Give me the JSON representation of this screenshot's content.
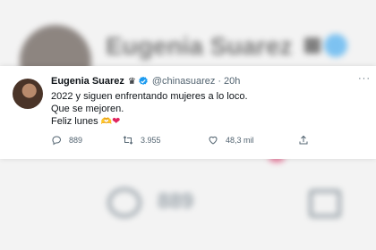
{
  "background": {
    "name": "Eugenia Suarez",
    "reply_count": "889"
  },
  "tweet": {
    "display_name": "Eugenia Suarez",
    "crown_emoji": "♛",
    "handle": "@chinasuarez",
    "separator": "·",
    "time": "20h",
    "more": "···",
    "lines": [
      "2022 y siguen enfrentando mujeres a lo loco.",
      "Que se mejoren.",
      "Feliz lunes"
    ],
    "emoji_1": "🫶",
    "emoji_2": "❤"
  },
  "actions": {
    "replies": "889",
    "retweets": "3.955",
    "likes": "48,3 mil"
  },
  "colors": {
    "verified": "#1d9bf0",
    "text": "#0f1419",
    "secondary": "#536471",
    "heart": "#e0245e"
  },
  "icons": [
    "verified-badge-icon",
    "crown-icon",
    "reply-icon",
    "retweet-icon",
    "like-icon",
    "share-icon"
  ]
}
